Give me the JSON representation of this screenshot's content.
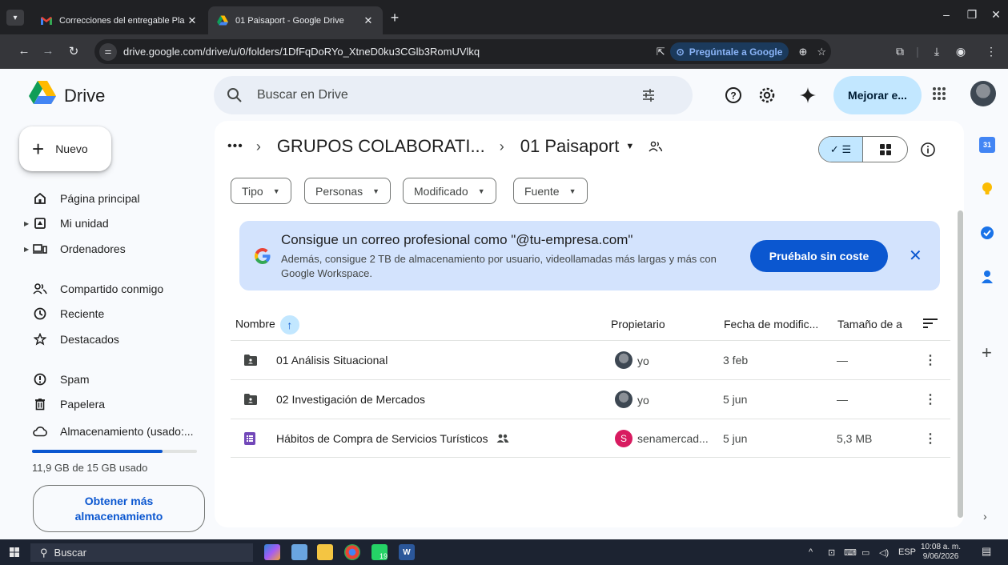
{
  "browser": {
    "tabs": [
      {
        "title": "Correcciones del entregable Pla",
        "favicon": "gmail-icon"
      },
      {
        "title": "01 Paisaport - Google Drive",
        "favicon": "drive-icon",
        "active": true
      }
    ],
    "url": "drive.google.com/drive/u/0/folders/1DfFqDoRYo_XtneD0ku3CGlb3RomUVlkq",
    "ask_google": "Pregúntale a Google"
  },
  "header": {
    "app_name": "Drive",
    "search_placeholder": "Buscar en Drive",
    "upgrade_label": "Mejorar e..."
  },
  "sidebar": {
    "new_label": "Nuevo",
    "items": [
      {
        "label": "Página principal",
        "icon": "home-icon"
      },
      {
        "label": "Mi unidad",
        "icon": "my-drive-icon"
      },
      {
        "label": "Ordenadores",
        "icon": "computers-icon"
      },
      {
        "label": "Compartido conmigo",
        "icon": "shared-icon"
      },
      {
        "label": "Reciente",
        "icon": "clock-icon"
      },
      {
        "label": "Destacados",
        "icon": "star-icon"
      },
      {
        "label": "Spam",
        "icon": "spam-icon"
      },
      {
        "label": "Papelera",
        "icon": "trash-icon"
      },
      {
        "label": "Almacenamiento (usado:...",
        "icon": "cloud-icon"
      }
    ],
    "storage_used_fraction": 0.79,
    "storage_text": "11,9 GB de 15 GB usado",
    "get_storage_label": "Obtener más almacenamiento"
  },
  "main": {
    "breadcrumb": {
      "more": "•••",
      "parent": "GRUPOS COLABORATI...",
      "current": "01 Paisaport"
    },
    "filters": [
      "Tipo",
      "Personas",
      "Modificado",
      "Fuente"
    ],
    "promo": {
      "title": "Consigue un correo profesional como \"@tu-empresa.com\"",
      "body": "Además, consigue 2 TB de almacenamiento por usuario, videollamadas más largas y más con Google Workspace.",
      "cta": "Pruébalo sin coste"
    },
    "columns": {
      "name": "Nombre",
      "owner": "Propietario",
      "modified": "Fecha de modific...",
      "size": "Tamaño de a"
    },
    "rows": [
      {
        "name": "01 Análisis Situacional",
        "type": "shared-folder",
        "owner": "yo",
        "modified": "3 feb",
        "size": "—"
      },
      {
        "name": "02 Investigación de Mercados",
        "type": "shared-folder",
        "owner": "yo",
        "modified": "5 jun",
        "size": "—"
      },
      {
        "name": "Hábitos de Compra de Servicios Turísticos",
        "type": "form",
        "owner": "senamercad...",
        "owner_initial": "S",
        "modified": "5 jun",
        "size": "5,3 MB"
      }
    ]
  },
  "taskbar": {
    "search_label": "Buscar",
    "language": "ESP",
    "time": "10:08 a. m.",
    "date": "9/06/2026",
    "whatsapp_badge": "19"
  },
  "colors": {
    "accent": "#0b57d0",
    "promo_bg": "#d3e3fd",
    "selected_bg": "#c2e7ff",
    "surface": "#f8fafd"
  }
}
